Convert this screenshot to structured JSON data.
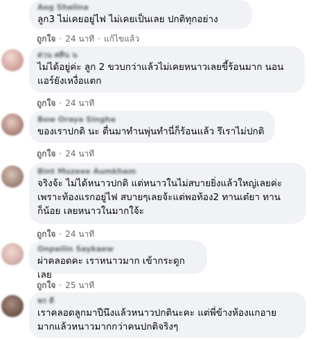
{
  "comments": [
    {
      "author": "Aog Shalina",
      "text": "ลูก3 ไม่เคยอยู่ไฟ ไม่เคยเป็นเลย ปกติทุกอย่าง",
      "like_label": "ถูกใจ",
      "time": "24 นาที",
      "edited": "แก้ไขแล้ว",
      "avatar_color": "#c9b9a8"
    },
    {
      "author": "ต่วน ศศิน น",
      "text": "ไม่ได้อยู่ค่ะ ลูก 2 ขวบกว่าแล้วไม่เคยหนาวเลยขี้ร้อนมาก นอน\nแอร์ยังเหงื่อแตก",
      "like_label": "ถูกใจ",
      "time": "24 นาที",
      "avatar_color": "#d7a9a3"
    },
    {
      "author": "Bow Oraya Singha",
      "text": "ของเราปกติ นะ ตื่นมาทำนพุ่นทำนี่ก็ร้อนแล้ว รึเราไม่ปกติ",
      "like_label": "ถูกใจ",
      "time": "24 นาที",
      "avatar_color": "#b58e86"
    },
    {
      "author": "Bint Muzeee Aumkham",
      "text": "จริงจ้ะ ไม่ได้หนาวปกติ แต่หนาวในไม่สบายยิ่งแล้วใหญ่เลยค่ะ\nเพราะท้องแรกอยู่ไฟ สบายๆเลยจ้ะแต่พอท้อง2 ทานเต๋ยา ทาน\nก็น้อย เลยหนาวในมากใจ้ะ",
      "like_label": "ถูกใจ",
      "time": "24 นาที",
      "avatar_color": "#a78d80"
    },
    {
      "author": "Onpailin Saykaew",
      "text": "ผ่าคลอดคะ เราหนาวมาก เข้ากระดูกเลย",
      "like_label": "ถูกใจ",
      "time": "25 นาที",
      "avatar_color": "#d8b4ae"
    },
    {
      "author": "พร ดี",
      "text": "เราคลอดลูกมาปีนึงแล้วหนาวปกตินะคะ แต่พี่ข้างห้องแกอาย\nมากแล้วหนาวมากกว่าคนปกติจริงๆ",
      "like_label": "",
      "time": "",
      "avatar_color": "#7a5f55"
    }
  ]
}
